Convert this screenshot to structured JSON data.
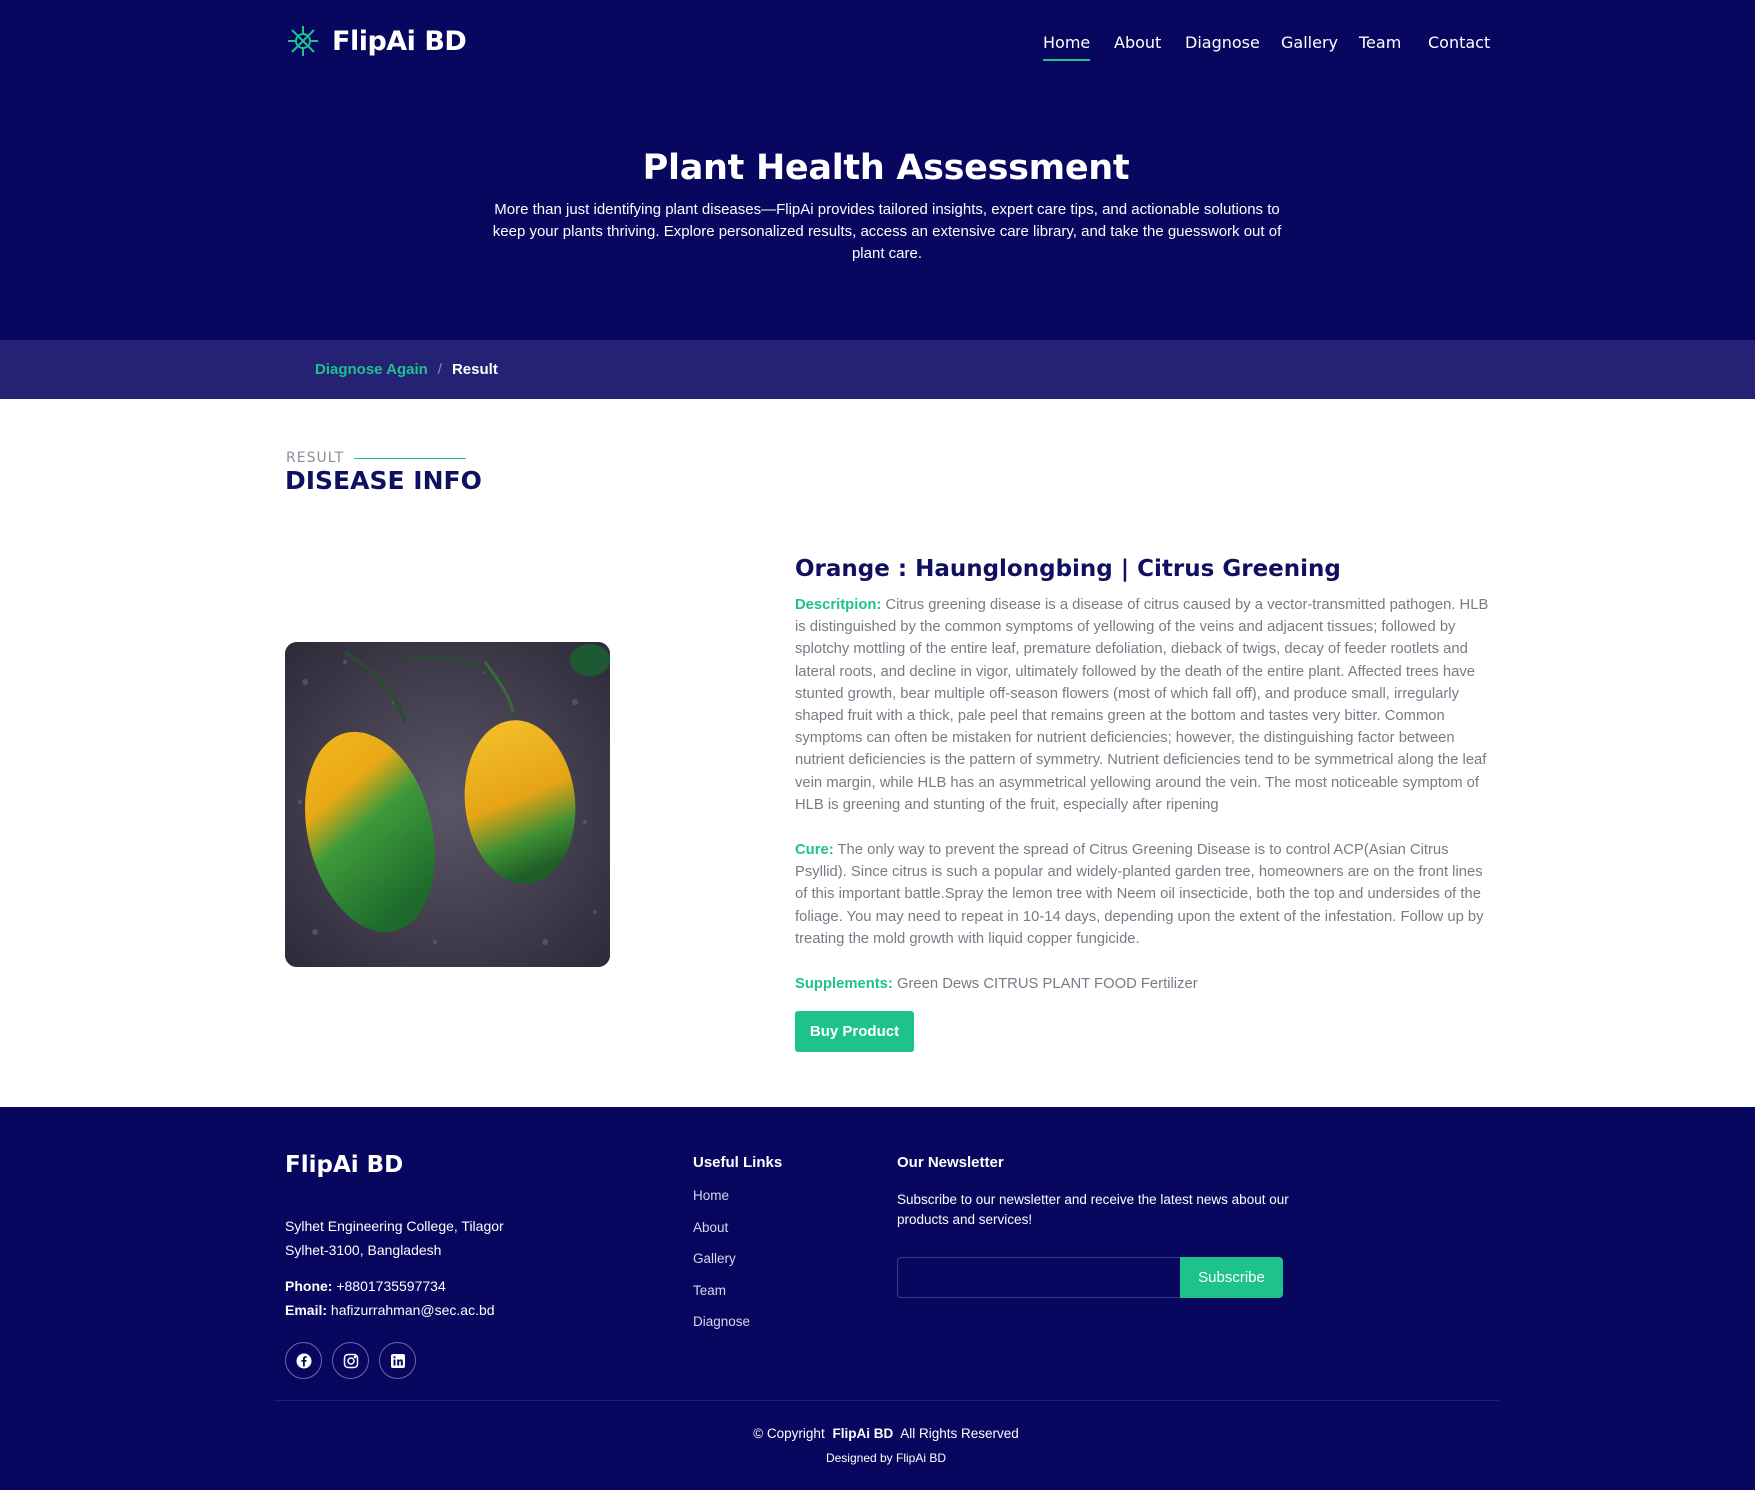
{
  "header": {
    "brand": "FlipAi BD",
    "nav": [
      {
        "label": "Home",
        "active": true
      },
      {
        "label": "About",
        "active": false
      },
      {
        "label": "Diagnose",
        "active": false
      },
      {
        "label": "Gallery",
        "active": false
      },
      {
        "label": "Team",
        "active": false
      },
      {
        "label": "Contact",
        "active": false
      }
    ]
  },
  "hero": {
    "title": "Plant Health Assessment",
    "subtitle": "More than just identifying plant diseases—FlipAi provides tailored insights, expert care tips, and actionable solutions to keep your plants thriving. Explore personalized results, access an extensive care library, and take the guesswork out of plant care."
  },
  "breadcrumb": {
    "link": "Diagnose Again",
    "separator": "/",
    "current": "Result"
  },
  "section": {
    "eyebrow": "RESULT",
    "title": "DISEASE INFO"
  },
  "result": {
    "title": "Orange : Haunglongbing | Citrus Greening",
    "description_label": "Descritpion:",
    "description": "Citrus greening disease is a disease of citrus caused by a vector-transmitted pathogen. HLB is distinguished by the common symptoms of yellowing of the veins and adjacent tissues; followed by splotchy mottling of the entire leaf, premature defoliation, dieback of twigs, decay of feeder rootlets and lateral roots, and decline in vigor, ultimately followed by the death of the entire plant. Affected trees have stunted growth, bear multiple off-season flowers (most of which fall off), and produce small, irregularly shaped fruit with a thick, pale peel that remains green at the bottom and tastes very bitter. Common symptoms can often be mistaken for nutrient deficiencies; however, the distinguishing factor between nutrient deficiencies is the pattern of symmetry. Nutrient deficiencies tend to be symmetrical along the leaf vein margin, while HLB has an asymmetrical yellowing around the vein. The most noticeable symptom of HLB is greening and stunting of the fruit, especially after ripening",
    "cure_label": "Cure:",
    "cure": "The only way to prevent the spread of Citrus Greening Disease is to control ACP(Asian Citrus Psyllid). Since citrus is such a popular and widely-planted garden tree, homeowners are on the front lines of this important battle.Spray the lemon tree with Neem oil insecticide, both the top and undersides of the foliage. You may need to repeat in 10-14 days, depending upon the extent of the infestation. Follow up by treating the mold growth with liquid copper fungicide.",
    "supplements_label": "Supplements:",
    "supplements": "Green Dews CITRUS PLANT FOOD Fertilizer",
    "buy_label": "Buy Product"
  },
  "footer": {
    "brand": "FlipAi BD",
    "address_line1": "Sylhet Engineering College, Tilagor",
    "address_line2": "Sylhet-3100, Bangladesh",
    "phone_label": "Phone:",
    "phone": "+8801735597734",
    "email_label": "Email:",
    "email": "hafizurrahman@sec.ac.bd",
    "social_icons": [
      "facebook-icon",
      "instagram-icon",
      "linkedin-icon"
    ],
    "links_heading": "Useful Links",
    "links": [
      "Home",
      "About",
      "Gallery",
      "Team",
      "Diagnose"
    ],
    "newsletter_heading": "Our Newsletter",
    "newsletter_text": "Subscribe to our newsletter and receive the latest news about our products and services!",
    "newsletter_placeholder": "",
    "subscribe_label": "Subscribe",
    "copyright_prefix": "© Copyright",
    "copyright_brand": "FlipAi BD",
    "copyright_suffix": "All Rights Reserved",
    "designed_by": "Designed by FlipAi BD"
  },
  "colors": {
    "navy": "#080760",
    "accent_green": "#1ec28b",
    "breadcrumb_bar": "#252174",
    "heading_navy": "#101060"
  }
}
